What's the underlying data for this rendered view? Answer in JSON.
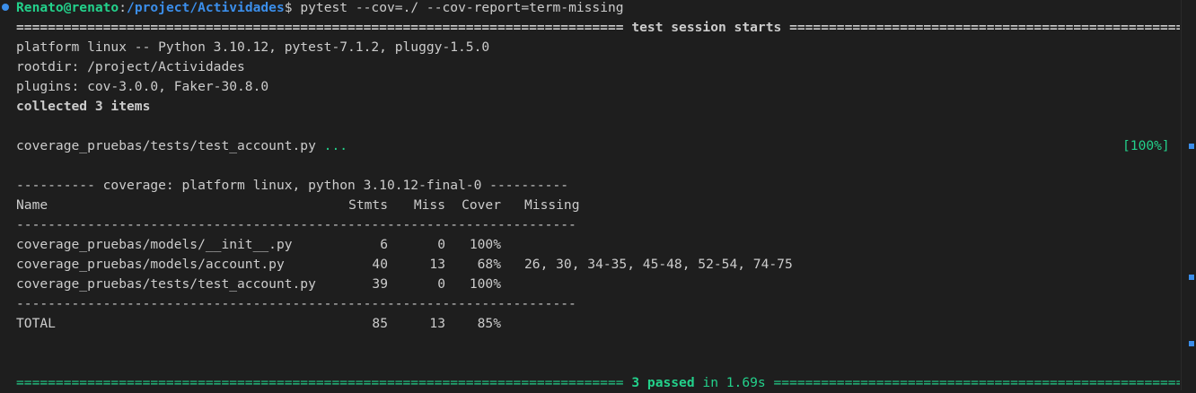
{
  "prompt": {
    "user_host": "Renato@renato",
    "sep": ":",
    "path": "/project/Actividades",
    "dollar": "$",
    "command": " pytest --cov=./ --cov-report=term-missing"
  },
  "session": {
    "left_rule": "=============================================================================",
    "title": " test session starts ",
    "right_rule": "=============================================================================="
  },
  "platform_line": "platform linux -- Python 3.10.12, pytest-7.1.2, pluggy-1.5.0",
  "rootdir_line": "rootdir: /project/Actividades",
  "plugins_line": "plugins: cov-3.0.0, Faker-30.8.0",
  "collected_line": "collected 3 items",
  "test_file": {
    "name": "coverage_pruebas/tests/test_account.py",
    "dots": " ...",
    "percent": "[100%]"
  },
  "coverage_header": "---------- coverage: platform linux, python 3.10.12-final-0 ----------",
  "table": {
    "headers": {
      "name": "Name",
      "stmts": "Stmts",
      "miss": "Miss",
      "cover": "Cover",
      "missing": "Missing"
    },
    "rule": "-----------------------------------------------------------------------",
    "rows": [
      {
        "name": "coverage_pruebas/models/__init__.py",
        "stmts": "6",
        "miss": "0",
        "cover": "100%",
        "missing": ""
      },
      {
        "name": "coverage_pruebas/models/account.py",
        "stmts": "40",
        "miss": "13",
        "cover": "68%",
        "missing": "26, 30, 34-35, 45-48, 52-54, 74-75"
      },
      {
        "name": "coverage_pruebas/tests/test_account.py",
        "stmts": "39",
        "miss": "0",
        "cover": "100%",
        "missing": ""
      }
    ],
    "total": {
      "name": "TOTAL",
      "stmts": "85",
      "miss": "13",
      "cover": "85%",
      "missing": ""
    }
  },
  "summary": {
    "left_rule": "=============================================================================",
    "passed": " 3 passed",
    "time": " in 1.69s ",
    "right_rule": "=============================================================================="
  },
  "colors": {
    "background": "#1e1e1e",
    "text": "#cccccc",
    "green": "#23d18b",
    "blue": "#3b8eea"
  }
}
